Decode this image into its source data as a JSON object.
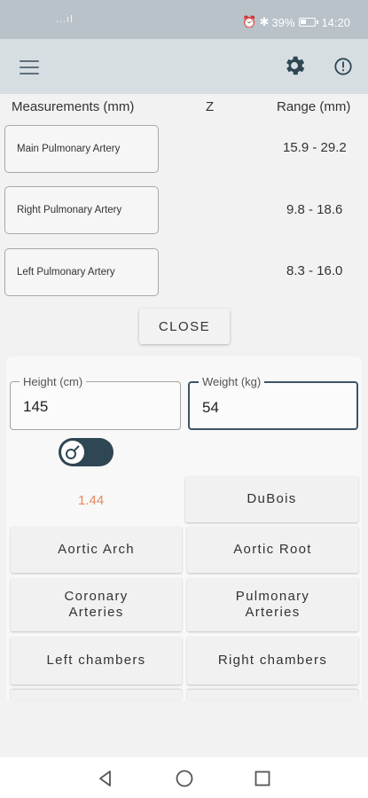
{
  "status_bar": {
    "signal_text": "...ıl",
    "battery": "39%",
    "time": "14:20",
    "icons": [
      "signal-icon",
      "wifi-icon",
      "alarm-icon",
      "bluetooth-icon",
      "battery-icon"
    ]
  },
  "toolbar": {
    "icons": [
      "hamburger-menu-icon",
      "gear-icon",
      "info-icon"
    ]
  },
  "measurements": {
    "headers": {
      "name": "Measurements (mm)",
      "z": "Z",
      "range": "Range (mm)"
    },
    "rows": [
      {
        "label": "Main Pulmonary Artery",
        "range": "15.9 - 29.2"
      },
      {
        "label": "Right Pulmonary Artery",
        "range": "9.8 - 18.6"
      },
      {
        "label": "Left Pulmonary Artery",
        "range": "8.3 - 16.0"
      }
    ]
  },
  "close_button": "CLOSE",
  "form": {
    "height": {
      "label": "Height (cm)",
      "value": "145"
    },
    "weight": {
      "label": "Weight (kg)",
      "value": "54"
    },
    "bsa_value": "1.44",
    "formula_button": "DuBois"
  },
  "categories": {
    "aortic_arch": "Aortic Arch",
    "aortic_root": "Aortic Root",
    "coronary_arteries": "Coronary\nArteries",
    "pulmonary_arteries": "Pulmonary\nArteries",
    "left_chambers": "Left chambers",
    "right_chambers": "Right chambers"
  },
  "colors": {
    "accent": "#2f4654",
    "bsa_text": "#e58a5e",
    "toolbar": "#d7dee2",
    "status_bar": "#b9c2c8"
  }
}
